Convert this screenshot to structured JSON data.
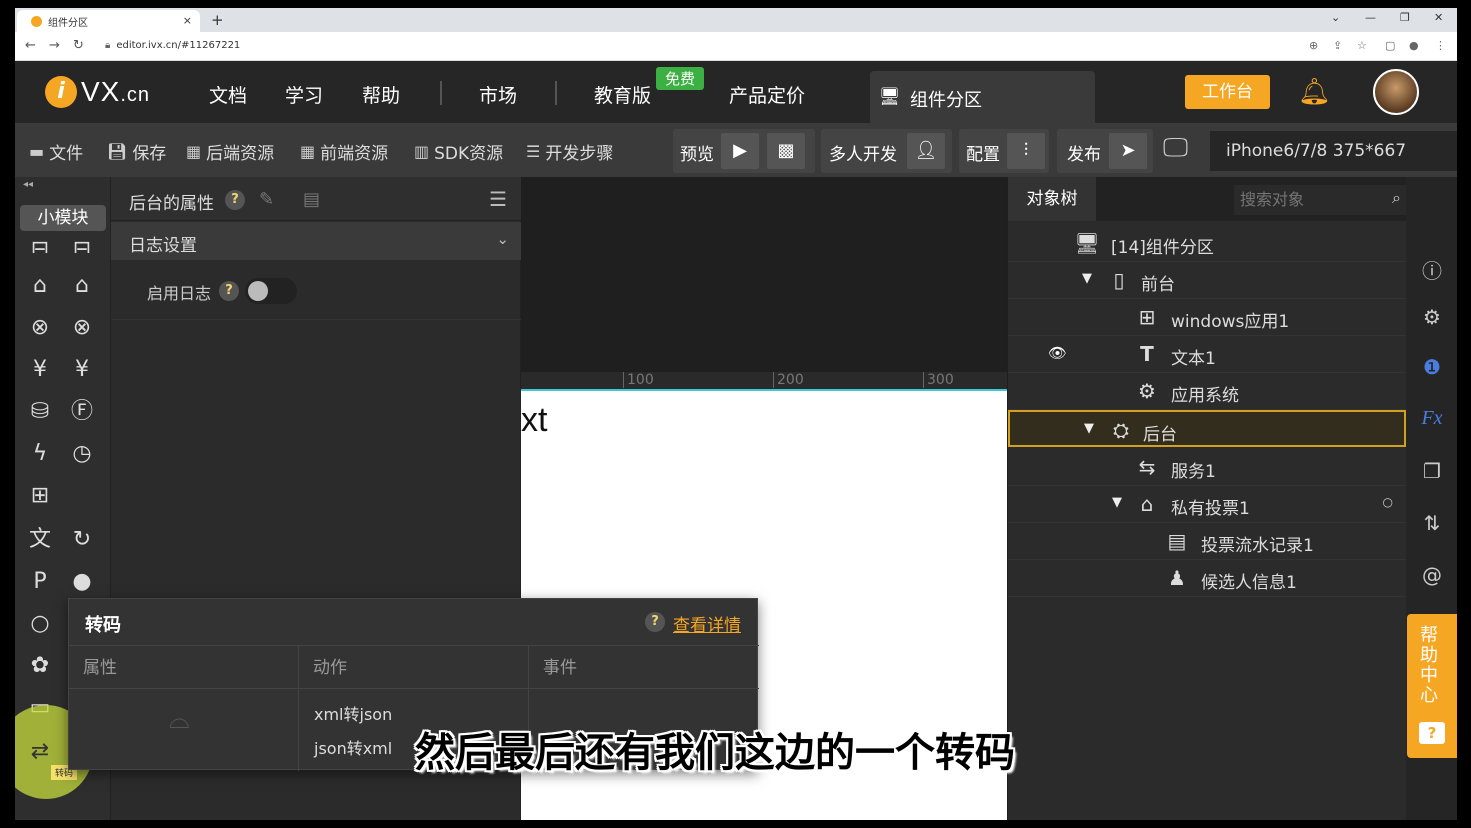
{
  "browser": {
    "tab_title": "组件分区",
    "tab_close": "×",
    "new_tab": "+",
    "url": "editor.ivx.cn/#11267221"
  },
  "header": {
    "logo_letter": "i",
    "logo_text": "VX",
    "logo_domain": ".cn",
    "nav": [
      "文档",
      "学习",
      "帮助",
      "市场",
      "教育版",
      "产品定价"
    ],
    "free_badge": "免费",
    "component_tab": "组件分区",
    "workbench": "工作台"
  },
  "toolbar": {
    "file": "文件",
    "save": "保存",
    "backend_res": "后端资源",
    "frontend_res": "前端资源",
    "sdk_res": "SDK资源",
    "dev_steps": "开发步骤",
    "preview": "预览",
    "multi_dev": "多人开发",
    "config": "配置",
    "publish": "发布",
    "device": "iPhone6/7/8 375*667"
  },
  "iconbar": {
    "module_chip": "小模块",
    "tooltip": "转码",
    "collapse": "◂◂"
  },
  "props": {
    "title": "后台的属性",
    "section": "日志设置",
    "log_label": "启用日志",
    "log_enabled": false
  },
  "canvas": {
    "ruler": [
      "100",
      "200",
      "300"
    ],
    "text": "xt"
  },
  "tree": {
    "tab": "对象树",
    "search_placeholder": "搜索对象",
    "nodes": [
      {
        "label": "[14]组件分区"
      },
      {
        "label": "前台"
      },
      {
        "label": "windows应用1"
      },
      {
        "label": "文本1"
      },
      {
        "label": "应用系统"
      },
      {
        "label": "后台"
      },
      {
        "label": "服务1"
      },
      {
        "label": "私有投票1"
      },
      {
        "label": "投票流水记录1"
      },
      {
        "label": "候选人信息1"
      }
    ]
  },
  "help": {
    "label": "帮助中心",
    "q": "?"
  },
  "popup": {
    "title": "转码",
    "link": "查看详情",
    "columns": [
      "属性",
      "动作",
      "事件"
    ],
    "actions": [
      "xml转json",
      "json转xml"
    ]
  },
  "subtitle": "然后最后还有我们这边的一个转码",
  "colors": {
    "accent": "#f5a623",
    "selection": "#d4a020",
    "free_badge": "#3cb043",
    "canvas_line": "#3ec9d6"
  }
}
